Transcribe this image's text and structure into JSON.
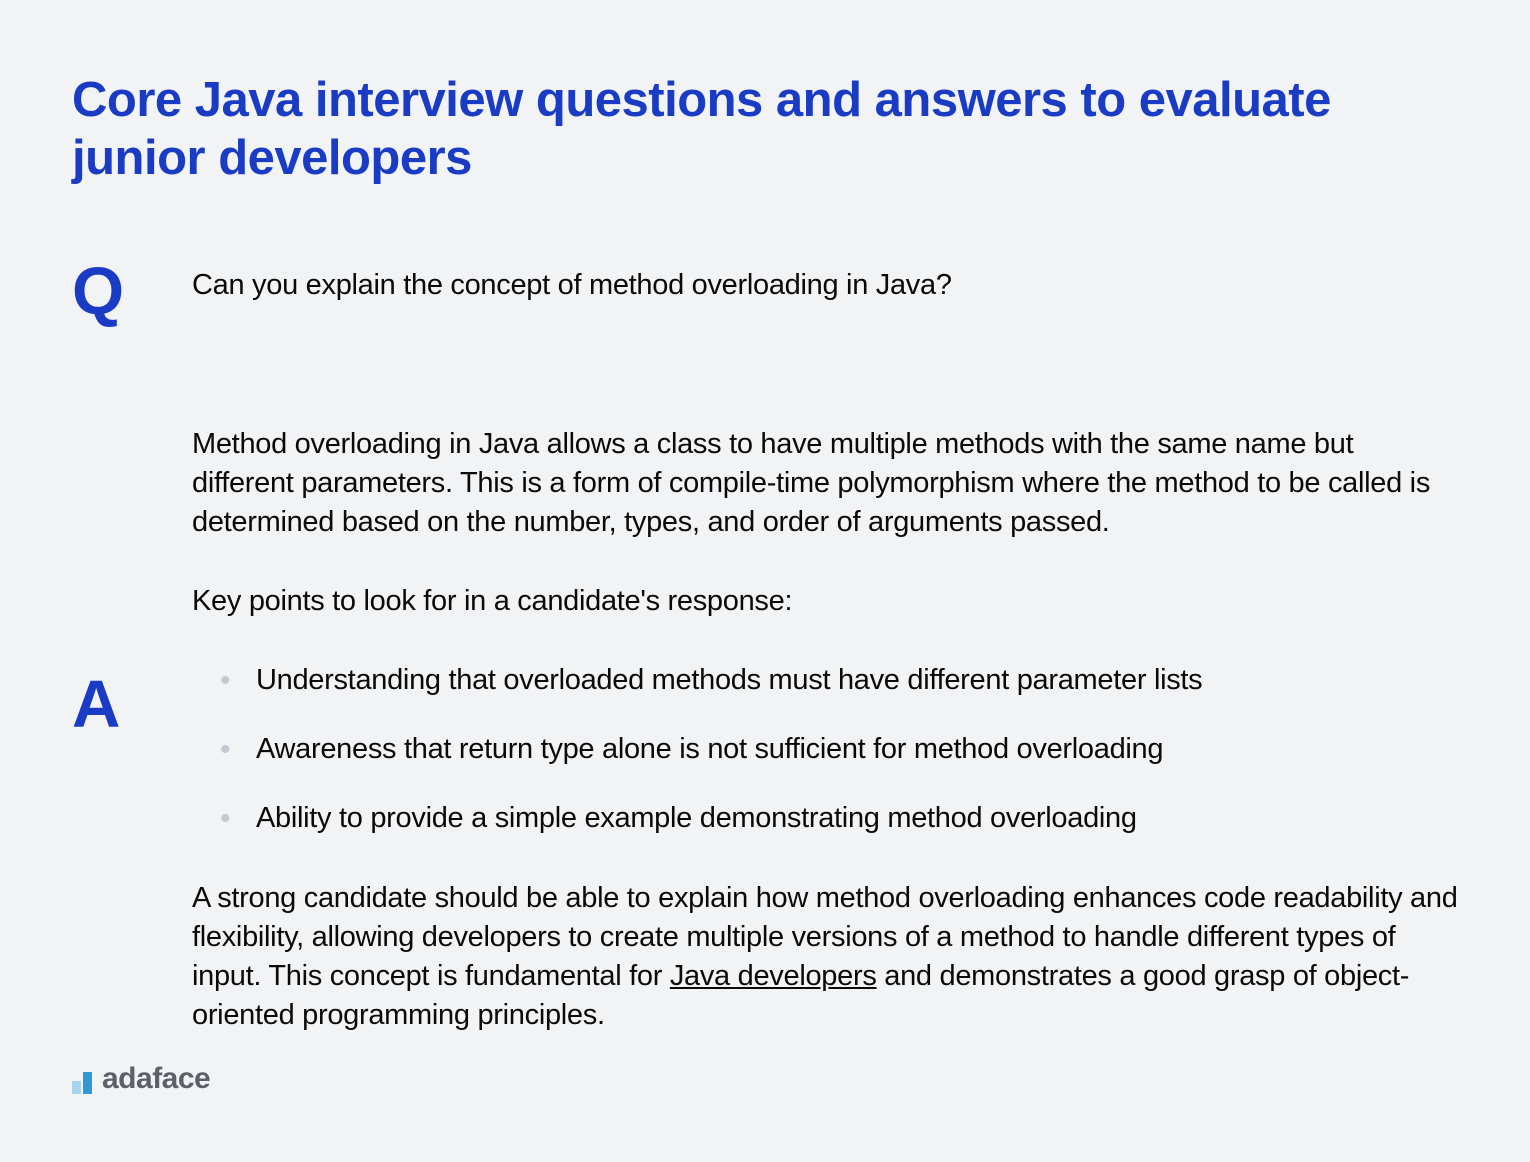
{
  "title": "Core Java interview questions and answers to evaluate junior developers",
  "question": {
    "marker": "Q",
    "text": "Can you explain the concept of method overloading in Java?"
  },
  "answer": {
    "marker": "A",
    "paragraph1": "Method overloading in Java allows a class to have multiple methods with the same name but different parameters. This is a form of compile-time polymorphism where the method to be called is determined based on the number, types, and order of arguments passed.",
    "paragraph2": "Key points to look for in a candidate's response:",
    "bullets": [
      "Understanding that overloaded methods must have different parameter lists",
      "Awareness that return type alone is not sufficient for method overloading",
      "Ability to provide a simple example demonstrating method overloading"
    ],
    "paragraph3_pre": "A strong candidate should be able to explain how method overloading enhances code readability and flexibility, allowing developers to create multiple versions of a method to handle different types of input. This concept is fundamental for ",
    "paragraph3_link": "Java developers",
    "paragraph3_post": " and demonstrates a good grasp of object-oriented programming principles."
  },
  "logo": {
    "text": "adaface"
  }
}
